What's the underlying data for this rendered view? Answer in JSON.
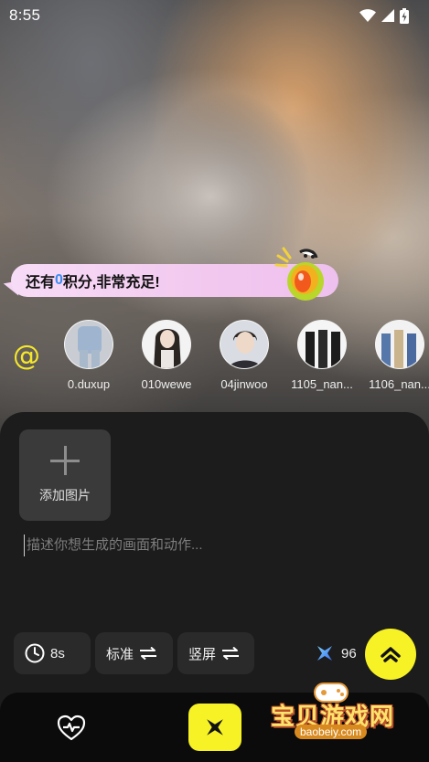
{
  "status_bar": {
    "time": "8:55"
  },
  "banner": {
    "prefix": "还有",
    "points": "0",
    "suffix": "积分,非常充足!"
  },
  "mention_symbol": "@",
  "avatars": [
    {
      "name": "0.duxup"
    },
    {
      "name": "010wewe"
    },
    {
      "name": "04jinwoo"
    },
    {
      "name": "1105_nan..."
    },
    {
      "name": "1106_nan..."
    }
  ],
  "composer": {
    "add_image_label": "添加图片",
    "prompt_placeholder": "描述你想生成的画面和动作..."
  },
  "options": {
    "duration": "8s",
    "quality": "标准",
    "orientation": "竖屏"
  },
  "credits": "96",
  "watermark": {
    "title": "宝贝游戏网",
    "url": "baobeiy.com"
  },
  "colors": {
    "accent": "#f7f226",
    "highlight": "#3a8df0",
    "sheet": "#1c1c1c"
  }
}
